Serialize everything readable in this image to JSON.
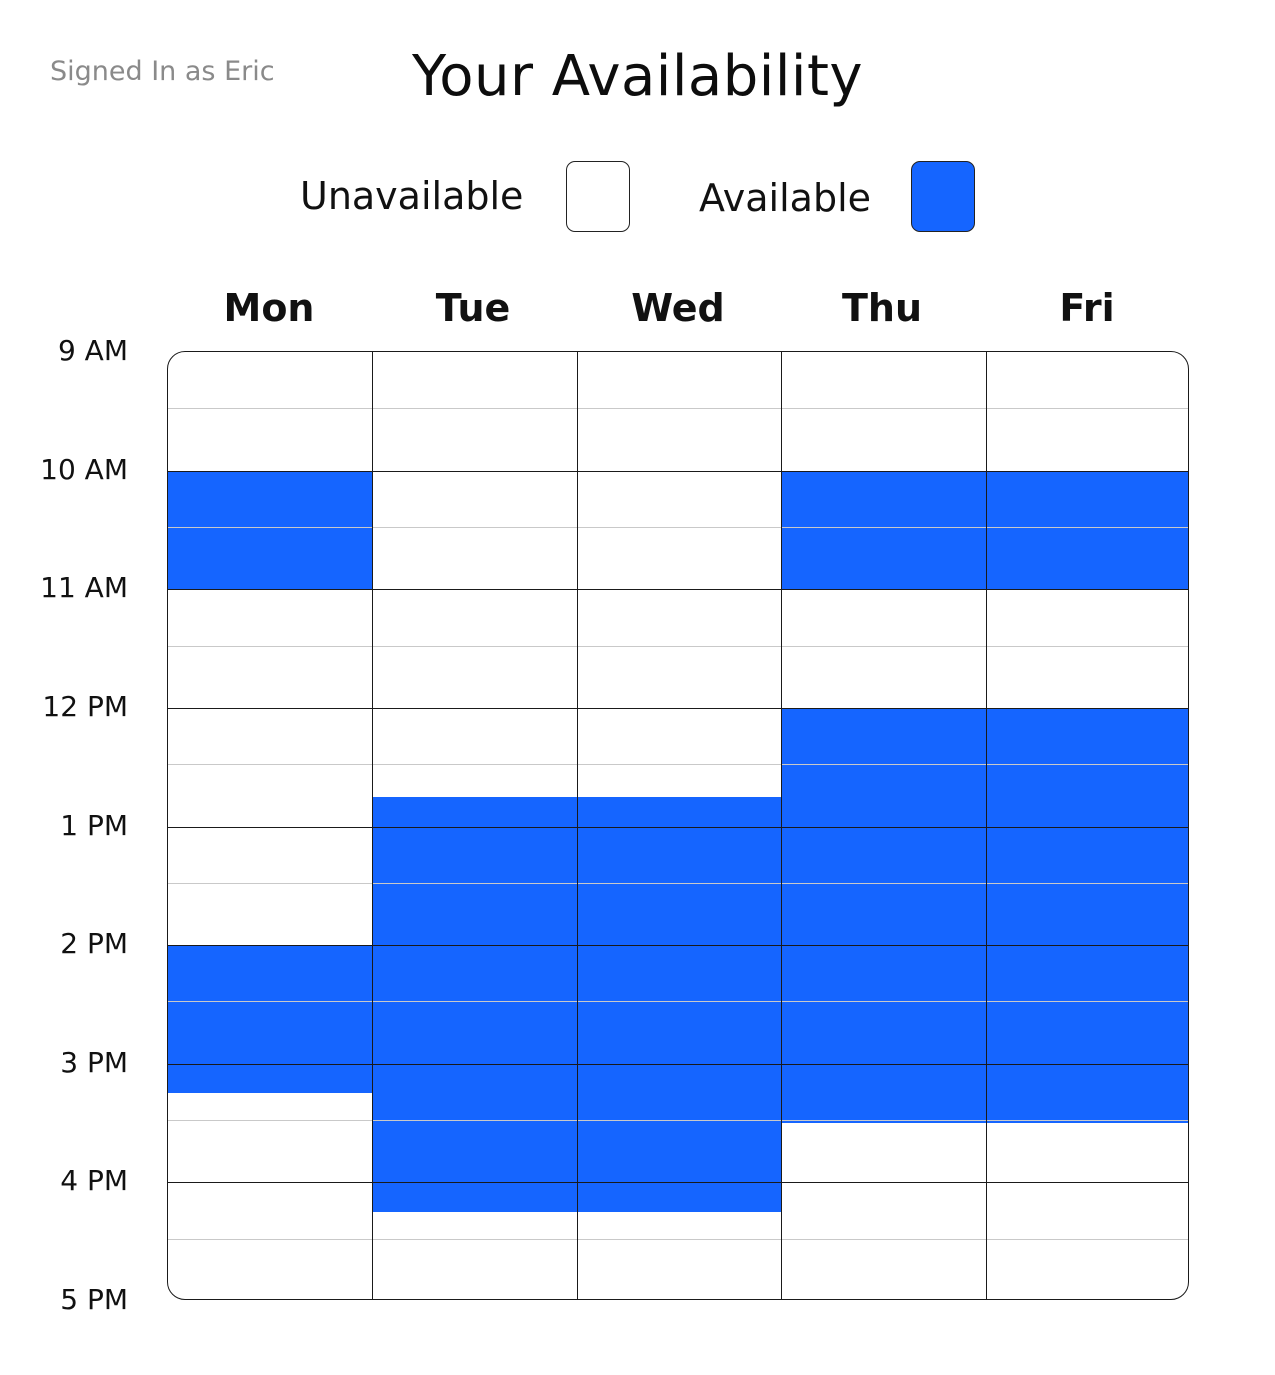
{
  "header": {
    "signed_in": "Signed In as Eric",
    "title": "Your Availability"
  },
  "legend": {
    "unavailable_label": "Unavailable",
    "available_label": "Available",
    "unavailable_color": "#ffffff",
    "available_color": "#1565ff"
  },
  "days": [
    "Mon",
    "Tue",
    "Wed",
    "Thu",
    "Fri"
  ],
  "times": [
    "9 AM",
    "10 AM",
    "11 AM",
    "12 PM",
    "1 PM",
    "2 PM",
    "3 PM",
    "4 PM",
    "5 PM"
  ],
  "availability": {
    "Mon": [
      [
        10,
        11
      ],
      [
        14,
        15.25
      ]
    ],
    "Tue": [
      [
        12.75,
        16.25
      ]
    ],
    "Wed": [
      [
        12.75,
        16.25
      ]
    ],
    "Thu": [
      [
        10,
        11
      ],
      [
        12,
        15.5
      ]
    ],
    "Fri": [
      [
        10,
        11
      ],
      [
        12,
        15.5
      ]
    ]
  }
}
